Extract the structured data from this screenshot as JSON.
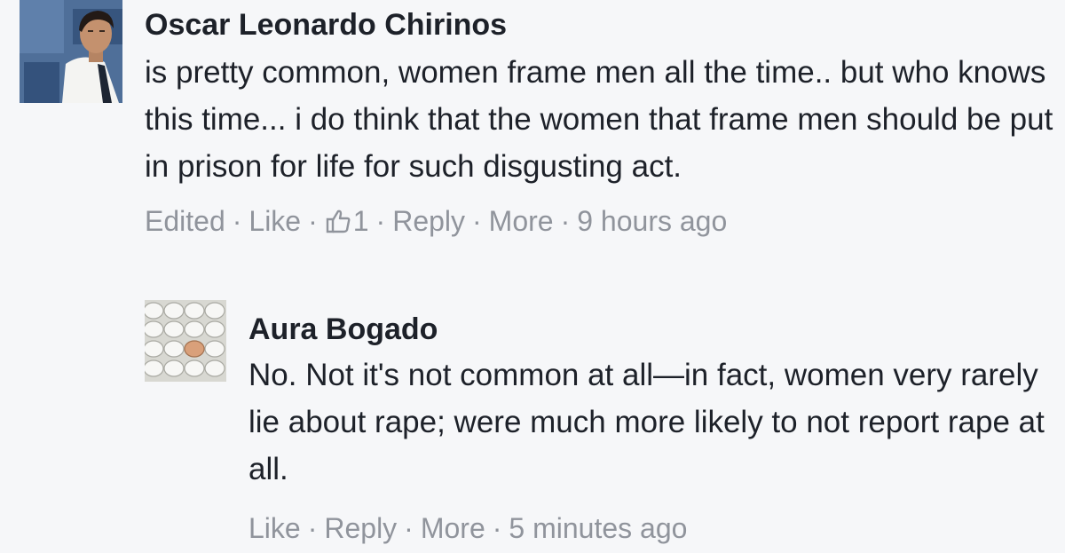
{
  "comments": [
    {
      "author": "Oscar Leonardo Chirinos",
      "text": "is pretty common, women frame men all the time.. but who knows this time... i do think that the women that frame men should be put in prison for life for such disgusting act.",
      "edited": "Edited",
      "like": "Like",
      "like_count": "1",
      "reply": "Reply",
      "more": "More",
      "time": "9 hours ago",
      "separator": "·",
      "avatar_icon": "profile-photo",
      "like_icon": "thumbs-up-icon"
    },
    {
      "author": "Aura Bogado",
      "text": "No. Not it's not common at all—in fact, women very rarely lie about rape; were much more likely to not report rape at all.",
      "like": "Like",
      "reply": "Reply",
      "more": "More",
      "time": "5 minutes ago",
      "separator": "·",
      "avatar_icon": "eggs-photo"
    }
  ],
  "colors": {
    "background": "#f6f7f9",
    "author": "#1d2129",
    "text": "#1d2129",
    "meta": "#90949c"
  }
}
